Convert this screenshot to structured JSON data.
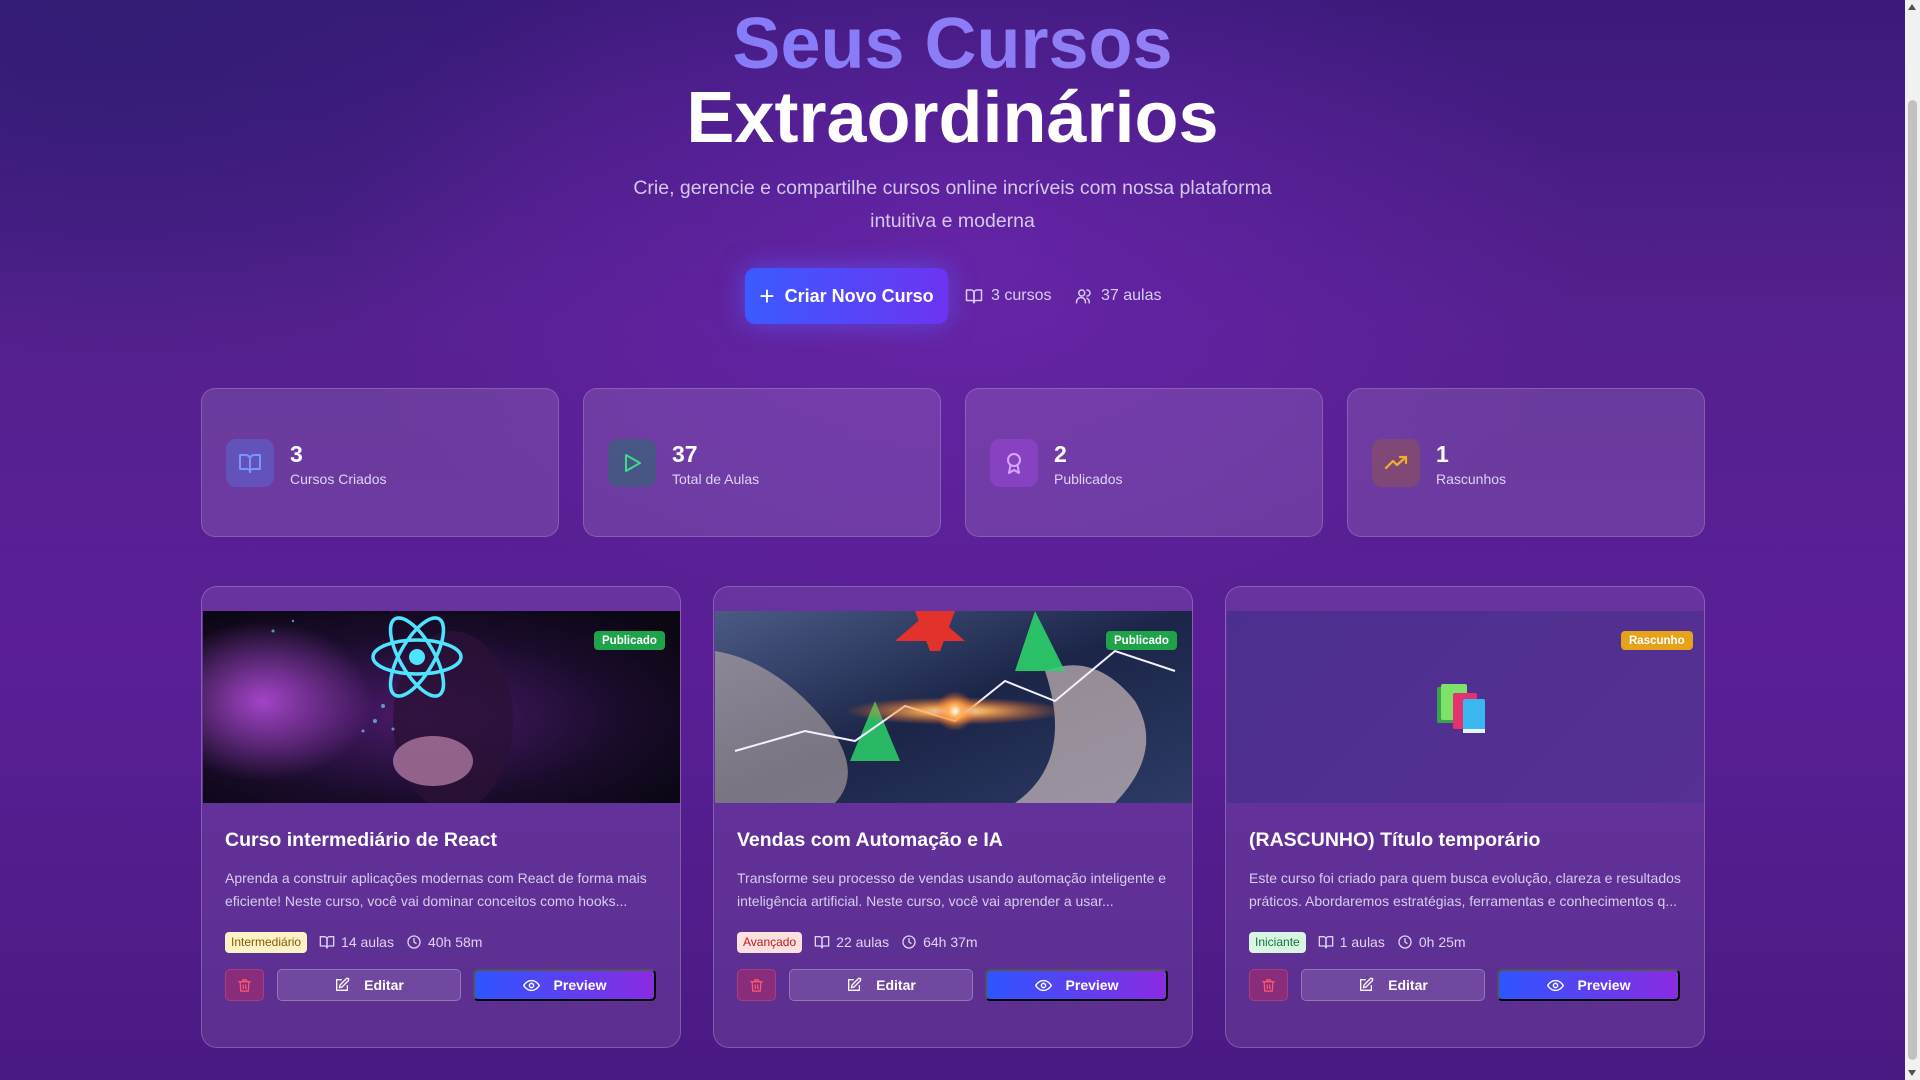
{
  "hero": {
    "title_line1": "Seus Cursos",
    "title_line2": "Extraordinários",
    "subtitle": "Crie, gerencie e compartilhe cursos online incríveis com nossa plataforma intuitiva e moderna",
    "cta_label": "Criar Novo Curso",
    "meta_courses": "3 cursos",
    "meta_lessons": "37 aulas"
  },
  "stats": [
    {
      "value": "3",
      "label": "Cursos Criados",
      "icon": "book-open-icon",
      "color": "#6f8bff"
    },
    {
      "value": "37",
      "label": "Total de Aulas",
      "icon": "play-icon",
      "color": "#31d07a"
    },
    {
      "value": "2",
      "label": "Publicados",
      "icon": "award-icon",
      "color": "#c48bff"
    },
    {
      "value": "1",
      "label": "Rascunhos",
      "icon": "trending-up-icon",
      "color": "#f5a623"
    }
  ],
  "courses": [
    {
      "status": "Publicado",
      "title": "Curso intermediário de React",
      "description": "Aprenda a construir aplicações modernas com React de forma mais eficiente! Neste curso, você vai dominar conceitos como hooks...",
      "level": "Intermediário",
      "lessons": "14 aulas",
      "duration": "40h 58m",
      "edit_label": "Editar",
      "preview_label": "Preview"
    },
    {
      "status": "Publicado",
      "title": "Vendas com Automação e IA",
      "description": "Transforme seu processo de vendas usando automação inteligente e inteligência artificial. Neste curso, você vai aprender a usar...",
      "level": "Avançado",
      "lessons": "22 aulas",
      "duration": "64h 37m",
      "edit_label": "Editar",
      "preview_label": "Preview"
    },
    {
      "status": "Rascunho",
      "title": "(RASCUNHO) Título temporário",
      "description": "Este curso foi criado para quem busca evolução, clareza e resultados práticos. Abordaremos estratégias, ferramentas e conhecimentos q...",
      "level": "Iniciante",
      "lessons": "1 aulas",
      "duration": "0h 25m",
      "edit_label": "Editar",
      "preview_label": "Preview"
    }
  ],
  "colors": {
    "accent_blue": "#3b5bff",
    "accent_purple": "#8a2be2",
    "published": "#1fa34a",
    "draft": "#e6a21a"
  }
}
